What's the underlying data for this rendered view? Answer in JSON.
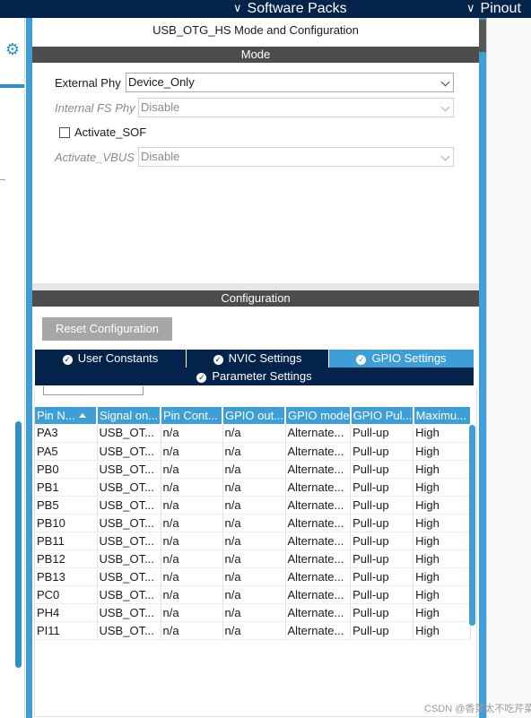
{
  "topbar": {
    "tabs": [
      {
        "label": "Software Packs",
        "icon": "chevron-down-icon"
      },
      {
        "label": "Pinout",
        "icon": "chevron-down-icon"
      }
    ]
  },
  "left_sidebar": {
    "icon": "gear-icon"
  },
  "panel": {
    "title": "USB_OTG_HS Mode and Configuration",
    "mode_header": "Mode",
    "config_header": "Configuration"
  },
  "mode": {
    "external_phy": {
      "label": "External Phy",
      "value": "Device_Only"
    },
    "internal_fs_phy": {
      "label": "Internal FS Phy",
      "value": "Disable"
    },
    "activate_sof": {
      "label": "Activate_SOF",
      "checked": false
    },
    "activate_vbus": {
      "label": "Activate_VBUS",
      "value": "Disable"
    }
  },
  "config": {
    "reset_label": "Reset Configuration",
    "tabs": [
      {
        "label": "User Constants",
        "active": false
      },
      {
        "label": "NVIC Settings",
        "active": false
      },
      {
        "label": "GPIO Settings",
        "active": true
      },
      {
        "label": "Parameter Settings",
        "active": false
      }
    ],
    "table": {
      "headers": [
        "Pin N...",
        "Signal on...",
        "Pin Cont...",
        "GPIO out...",
        "GPIO mode",
        "GPIO Pul...",
        "Maximu..."
      ],
      "rows": [
        [
          "PA3",
          "USB_OT...",
          "n/a",
          "n/a",
          "Alternate...",
          "Pull-up",
          "High"
        ],
        [
          "PA5",
          "USB_OT...",
          "n/a",
          "n/a",
          "Alternate...",
          "Pull-up",
          "High"
        ],
        [
          "PB0",
          "USB_OT...",
          "n/a",
          "n/a",
          "Alternate...",
          "Pull-up",
          "High"
        ],
        [
          "PB1",
          "USB_OT...",
          "n/a",
          "n/a",
          "Alternate...",
          "Pull-up",
          "High"
        ],
        [
          "PB5",
          "USB_OT...",
          "n/a",
          "n/a",
          "Alternate...",
          "Pull-up",
          "High"
        ],
        [
          "PB10",
          "USB_OT...",
          "n/a",
          "n/a",
          "Alternate...",
          "Pull-up",
          "High"
        ],
        [
          "PB11",
          "USB_OT...",
          "n/a",
          "n/a",
          "Alternate...",
          "Pull-up",
          "High"
        ],
        [
          "PB12",
          "USB_OT...",
          "n/a",
          "n/a",
          "Alternate...",
          "Pull-up",
          "High"
        ],
        [
          "PB13",
          "USB_OT...",
          "n/a",
          "n/a",
          "Alternate...",
          "Pull-up",
          "High"
        ],
        [
          "PC0",
          "USB_OT...",
          "n/a",
          "n/a",
          "Alternate...",
          "Pull-up",
          "High"
        ],
        [
          "PH4",
          "USB_OT...",
          "n/a",
          "n/a",
          "Alternate...",
          "Pull-up",
          "High"
        ],
        [
          "PI11",
          "USB_OT...",
          "n/a",
          "n/a",
          "Alternate...",
          "Pull-up",
          "High"
        ]
      ]
    }
  },
  "watermark": "CSDN @香菜太不吃芹菜",
  "colors": {
    "topbar": "#03234b",
    "accent_blue": "#3e9fd8",
    "section_bar": "#4d4d4d",
    "reset_button": "#a6a6a6"
  }
}
